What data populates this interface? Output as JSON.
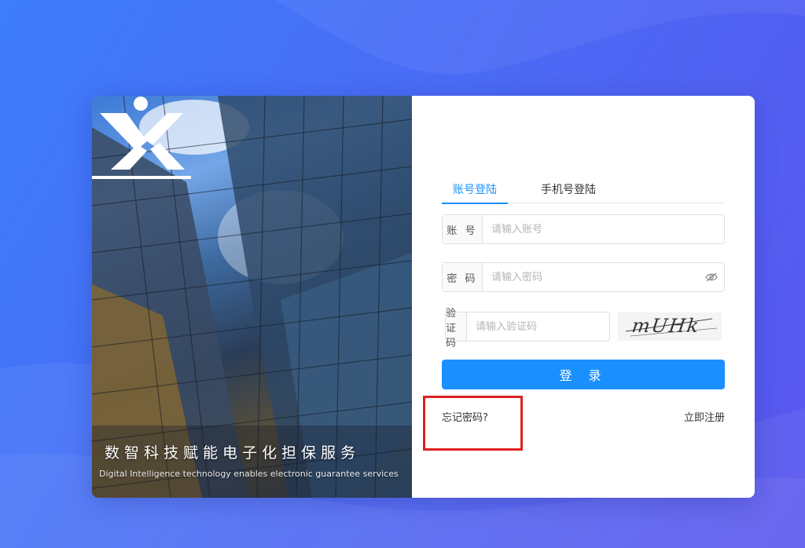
{
  "hero": {
    "slogan_cn": "数智科技赋能电子化担保服务",
    "slogan_en": "Digital Intelligence technology enables electronic guarantee services",
    "logo_icon": "brand-logo-icon"
  },
  "tabs": [
    {
      "label": "账号登陆",
      "active": true
    },
    {
      "label": "手机号登陆",
      "active": false
    }
  ],
  "account": {
    "prefix": "账 号",
    "placeholder": "请输入账号",
    "value": ""
  },
  "password": {
    "prefix": "密 码",
    "placeholder": "请输入密码",
    "value": "",
    "toggle_icon": "eye-hidden-icon"
  },
  "captcha": {
    "prefix": "验证码",
    "placeholder": "请输入验证码",
    "value": "",
    "image_text": "mUHk"
  },
  "login_button": "登 录",
  "forgot_link": "忘记密码?",
  "register_link": "立即注册",
  "colors": {
    "primary": "#1a90ff",
    "highlight": "#e02020",
    "background": "#4a6bf5"
  }
}
